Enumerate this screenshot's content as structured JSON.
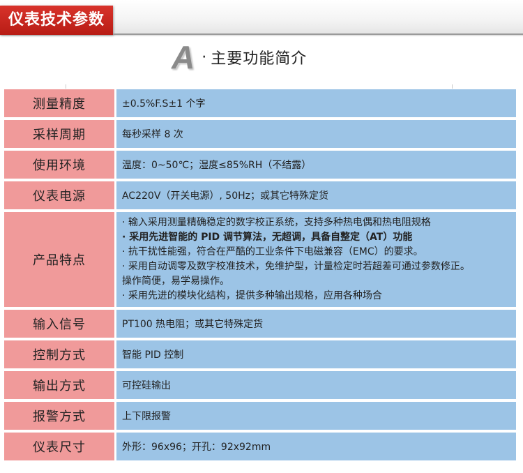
{
  "header": {
    "title": "仪表技术参数"
  },
  "section": {
    "letter": "A",
    "dot": "·",
    "title": "主要功能简介"
  },
  "specs": [
    {
      "label": "测量精度",
      "value": "±0.5%F.S±1 个字"
    },
    {
      "label": "采样周期",
      "value": "每秒采样 8 次"
    },
    {
      "label": "使用环境",
      "value": "温度：0~50℃；湿度≤85%RH（不结露）"
    },
    {
      "label": "仪表电源",
      "value": "AC220V（开关电源）, 50Hz；或其它特殊定货"
    },
    {
      "label": "产品特点",
      "lines": [
        "· 输入采用测量精确稳定的数字校正系统，支持多种热电偶和热电阻规格",
        "· 采用先进智能的 PID 调节算法，无超调，具备自整定（AT）功能",
        "· 抗干扰性能强，符合在严酷的工业条件下电磁兼容（EMC）的要求。",
        "· 采用自动调零及数字校准技术，免维护型，计量检定时若超差可通过参数修正。",
        "操作简便，易学易操作。",
        "· 采用先进的模块化结构，提供多种输出规格，应用各种场合"
      ]
    },
    {
      "label": "输入信号",
      "value": "PT100 热电阻；或其它特殊定货"
    },
    {
      "label": "控制方式",
      "value": "智能 PID 控制"
    },
    {
      "label": "输出方式",
      "value": "可控硅输出"
    },
    {
      "label": "报警方式",
      "value": "上下限报警"
    },
    {
      "label": "仪表尺寸",
      "value": "外形：96x96；开孔：92x92mm"
    }
  ],
  "colors": {
    "header_red": "#c62820",
    "label_bg": "#f09a9a",
    "value_bg": "#9cc4e6"
  }
}
